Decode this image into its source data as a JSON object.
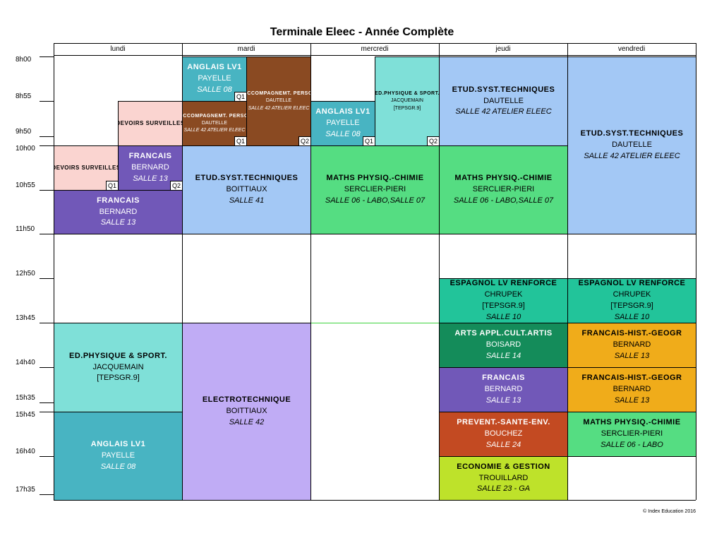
{
  "title": "Terminale Eleec - Année Complète",
  "copyright": "© Index Education 2016",
  "days": [
    "lundi",
    "mardi",
    "mercredi",
    "jeudi",
    "vendredi"
  ],
  "times": [
    "8h00",
    "8h55",
    "9h50",
    "10h00",
    "10h55",
    "11h50",
    "12h50",
    "13h45",
    "14h40",
    "15h35",
    "15h45",
    "16h40",
    "17h35"
  ],
  "courses": [
    {
      "day": 0,
      "start": 15,
      "end": 17,
      "sub": 0,
      "subs": 2,
      "color": "#fad4d0",
      "fg": "#000",
      "size": 8,
      "lines": [
        "DEVOIRS SURVEILLES"
      ],
      "q": "Q1"
    },
    {
      "day": 0,
      "start": 13,
      "end": 15,
      "sub": 1,
      "subs": 2,
      "color": "#fad4d0",
      "fg": "#000",
      "size": 8,
      "lines": [
        "DEVOIRS SURVEILLES"
      ],
      "q": ""
    },
    {
      "day": 0,
      "start": 15,
      "end": 17,
      "sub": 1,
      "subs": 2,
      "color": "#7158b8",
      "fg": "#fff",
      "size": 11,
      "lines": [
        "FRANCAIS",
        "BERNARD",
        "SALLE 13"
      ],
      "q": "Q2"
    },
    {
      "day": 0,
      "start": 17,
      "end": 19,
      "sub": 0,
      "subs": 1,
      "color": "#7158b8",
      "fg": "#fff",
      "size": 11,
      "lines": [
        "FRANCAIS",
        "BERNARD",
        "SALLE 13"
      ],
      "q": ""
    },
    {
      "day": 0,
      "start": 23,
      "end": 25,
      "sub": 0,
      "subs": 1,
      "color": "#7fe0d8",
      "fg": "#000",
      "size": 11,
      "lines": [
        "ED.PHYSIQUE & SPORT.",
        "JACQUEMAIN",
        "[TEPSGR.9]"
      ],
      "q": ""
    },
    {
      "day": 0,
      "start": 25,
      "end": 27,
      "sub": 0,
      "subs": 1,
      "color": "#48b4c2",
      "fg": "#fff",
      "size": 11,
      "lines": [
        "ANGLAIS LV1",
        "PAYELLE",
        "SALLE 08"
      ],
      "q": ""
    },
    {
      "day": 1,
      "start": 11,
      "end": 13,
      "sub": 0,
      "subs": 2,
      "color": "#48b4c2",
      "fg": "#fff",
      "size": 11,
      "lines": [
        "ANGLAIS LV1",
        "PAYELLE",
        "SALLE 08"
      ],
      "q": "Q1"
    },
    {
      "day": 1,
      "start": 13,
      "end": 15,
      "sub": 0,
      "subs": 2,
      "color": "#8a4a22",
      "fg": "#fff",
      "size": 7,
      "lines": [
        "ACCOMPAGNEMT. PERSO.",
        "DAUTELLE",
        "SALLE 42 ATELIER ELEEC"
      ],
      "q": "Q1"
    },
    {
      "day": 1,
      "start": 11,
      "end": 15,
      "sub": 1,
      "subs": 2,
      "color": "#8a4a22",
      "fg": "#fff",
      "size": 7,
      "lines": [
        "ACCOMPAGNEMT. PERSO.",
        "DAUTELLE",
        "SALLE 42 ATELIER ELEEC"
      ],
      "q": "Q2"
    },
    {
      "day": 1,
      "start": 15,
      "end": 19,
      "sub": 0,
      "subs": 1,
      "color": "#a3c8f5",
      "fg": "#000",
      "size": 11,
      "lines": [
        "ETUD.SYST.TECHNIQUES",
        "BOITTIAUX",
        "SALLE 41"
      ],
      "q": ""
    },
    {
      "day": 1,
      "start": 23,
      "end": 29,
      "sub": 0,
      "subs": 1,
      "color": "#c0acf5",
      "fg": "#000",
      "size": 11,
      "lines": [
        "ELECTROTECHNIQUE",
        "BOITTIAUX",
        "SALLE 42"
      ],
      "q": ""
    },
    {
      "day": 2,
      "start": 11,
      "end": 15,
      "sub": 1,
      "subs": 2,
      "color": "#7fe0d8",
      "fg": "#000",
      "size": 7,
      "lines": [
        "ED.PHYSIQUE & SPORT.",
        "JACQUEMAIN",
        "[TEPSGR.9]"
      ],
      "q": "Q2"
    },
    {
      "day": 2,
      "start": 13,
      "end": 15,
      "sub": 0,
      "subs": 2,
      "color": "#48b4c2",
      "fg": "#fff",
      "size": 11,
      "lines": [
        "ANGLAIS LV1",
        "PAYELLE",
        "SALLE 08"
      ],
      "q": "Q1"
    },
    {
      "day": 2,
      "start": 15,
      "end": 19,
      "sub": 0,
      "subs": 1,
      "color": "#55dd82",
      "fg": "#000",
      "size": 11,
      "lines": [
        "MATHS PHYSIQ.-CHIMIE",
        "SERCLIER-PIERI",
        "SALLE 06 - LABO,SALLE 07"
      ],
      "q": ""
    },
    {
      "day": 3,
      "start": 11,
      "end": 15,
      "sub": 0,
      "subs": 1,
      "color": "#a3c8f5",
      "fg": "#000",
      "size": 11,
      "lines": [
        "ETUD.SYST.TECHNIQUES",
        "DAUTELLE",
        "SALLE 42 ATELIER ELEEC"
      ],
      "q": ""
    },
    {
      "day": 3,
      "start": 15,
      "end": 19,
      "sub": 0,
      "subs": 1,
      "color": "#55dd82",
      "fg": "#000",
      "size": 11,
      "lines": [
        "MATHS PHYSIQ.-CHIMIE",
        "SERCLIER-PIERI",
        "SALLE 06 - LABO,SALLE 07"
      ],
      "q": ""
    },
    {
      "day": 3,
      "start": 21,
      "end": 23,
      "sub": 0,
      "subs": 1,
      "color": "#22c49a",
      "fg": "#000",
      "size": 11,
      "lines": [
        "ESPAGNOL LV RENFORCE",
        "CHRUPEK",
        "[TEPSGR.9]",
        "SALLE 10"
      ],
      "q": ""
    },
    {
      "day": 3,
      "start": 23,
      "end": 24,
      "sub": 0,
      "subs": 1,
      "color": "#148c5a",
      "fg": "#fff",
      "size": 11,
      "lines": [
        "ARTS APPL.CULT.ARTIS",
        "BOISARD",
        "SALLE 14"
      ],
      "q": ""
    },
    {
      "day": 3,
      "start": 24,
      "end": 25,
      "sub": 0,
      "subs": 1,
      "color": "#7158b8",
      "fg": "#fff",
      "size": 11,
      "lines": [
        "FRANCAIS",
        "BERNARD",
        "SALLE 13"
      ],
      "q": ""
    },
    {
      "day": 3,
      "start": 25,
      "end": 26,
      "sub": 0,
      "subs": 1,
      "color": "#c34a22",
      "fg": "#fff",
      "size": 11,
      "lines": [
        "PREVENT.-SANTE-ENV.",
        "BOUCHEZ",
        "SALLE 24"
      ],
      "q": ""
    },
    {
      "day": 3,
      "start": 26,
      "end": 27,
      "sub": 0,
      "subs": 1,
      "color": "#bee22a",
      "fg": "#000",
      "size": 11,
      "lines": [
        "ECONOMIE & GESTION",
        "TROUILLARD",
        "SALLE 23 - GA"
      ],
      "q": ""
    },
    {
      "day": 4,
      "start": 11,
      "end": 19,
      "sub": 0,
      "subs": 1,
      "color": "#a3c8f5",
      "fg": "#000",
      "size": 11,
      "lines": [
        "ETUD.SYST.TECHNIQUES",
        "DAUTELLE",
        "SALLE 42 ATELIER ELEEC"
      ],
      "q": ""
    },
    {
      "day": 4,
      "start": 21,
      "end": 23,
      "sub": 0,
      "subs": 1,
      "color": "#22c49a",
      "fg": "#000",
      "size": 11,
      "lines": [
        "ESPAGNOL LV RENFORCE",
        "CHRUPEK",
        "[TEPSGR.9]",
        "SALLE 10"
      ],
      "q": ""
    },
    {
      "day": 4,
      "start": 23,
      "end": 24,
      "sub": 0,
      "subs": 1,
      "color": "#f0ac1a",
      "fg": "#000",
      "size": 11,
      "lines": [
        "FRANCAIS-HIST.-GEOGR",
        "BERNARD",
        "SALLE 13"
      ],
      "q": ""
    },
    {
      "day": 4,
      "start": 24,
      "end": 25,
      "sub": 0,
      "subs": 1,
      "color": "#f0ac1a",
      "fg": "#000",
      "size": 11,
      "lines": [
        "FRANCAIS-HIST.-GEOGR",
        "BERNARD",
        "SALLE 13"
      ],
      "q": ""
    },
    {
      "day": 4,
      "start": 25,
      "end": 26,
      "sub": 0,
      "subs": 1,
      "color": "#55dd82",
      "fg": "#000",
      "size": 11,
      "lines": [
        "MATHS PHYSIQ.-CHIMIE",
        "SERCLIER-PIERI",
        "SALLE 06 - LABO"
      ],
      "q": ""
    }
  ]
}
